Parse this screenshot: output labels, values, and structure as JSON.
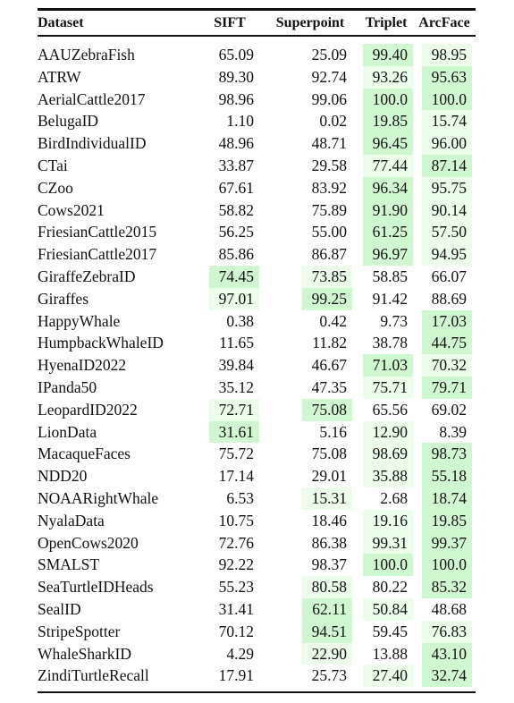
{
  "table": {
    "columns": [
      "Dataset",
      "SIFT",
      "Superpoint",
      "Triplet",
      "ArcFace"
    ],
    "highlight_colors": {
      "best": "#d0f8d0",
      "second": "#ecfdec"
    },
    "rows": [
      {
        "dataset": "AAUZebraFish",
        "values": [
          "65.09",
          "25.09",
          "99.40",
          "98.95"
        ],
        "marks": [
          "",
          "",
          "best",
          "second"
        ]
      },
      {
        "dataset": "ATRW",
        "values": [
          "89.30",
          "92.74",
          "93.26",
          "95.63"
        ],
        "marks": [
          "",
          "",
          "second",
          "best"
        ]
      },
      {
        "dataset": "AerialCattle2017",
        "values": [
          "98.96",
          "99.06",
          "100.0",
          "100.0"
        ],
        "marks": [
          "",
          "",
          "best",
          "best"
        ]
      },
      {
        "dataset": "BelugaID",
        "values": [
          "1.10",
          "0.02",
          "19.85",
          "15.74"
        ],
        "marks": [
          "",
          "",
          "best",
          "second"
        ]
      },
      {
        "dataset": "BirdIndividualID",
        "values": [
          "48.96",
          "48.71",
          "96.45",
          "96.00"
        ],
        "marks": [
          "",
          "",
          "best",
          "second"
        ]
      },
      {
        "dataset": "CTai",
        "values": [
          "33.87",
          "29.58",
          "77.44",
          "87.14"
        ],
        "marks": [
          "",
          "",
          "second",
          "best"
        ]
      },
      {
        "dataset": "CZoo",
        "values": [
          "67.61",
          "83.92",
          "96.34",
          "95.75"
        ],
        "marks": [
          "",
          "",
          "best",
          "second"
        ]
      },
      {
        "dataset": "Cows2021",
        "values": [
          "58.82",
          "75.89",
          "91.90",
          "90.14"
        ],
        "marks": [
          "",
          "",
          "best",
          "second"
        ]
      },
      {
        "dataset": "FriesianCattle2015",
        "values": [
          "56.25",
          "55.00",
          "61.25",
          "57.50"
        ],
        "marks": [
          "",
          "",
          "best",
          "second"
        ]
      },
      {
        "dataset": "FriesianCattle2017",
        "values": [
          "85.86",
          "86.87",
          "96.97",
          "94.95"
        ],
        "marks": [
          "",
          "",
          "best",
          "second"
        ]
      },
      {
        "dataset": "GiraffeZebraID",
        "values": [
          "74.45",
          "73.85",
          "58.85",
          "66.07"
        ],
        "marks": [
          "best",
          "second",
          "",
          ""
        ]
      },
      {
        "dataset": "Giraffes",
        "values": [
          "97.01",
          "99.25",
          "91.42",
          "88.69"
        ],
        "marks": [
          "second",
          "best",
          "",
          ""
        ]
      },
      {
        "dataset": "HappyWhale",
        "values": [
          "0.38",
          "0.42",
          "9.73",
          "17.03"
        ],
        "marks": [
          "",
          "",
          "",
          "best"
        ]
      },
      {
        "dataset": "HumpbackWhaleID",
        "values": [
          "11.65",
          "11.82",
          "38.78",
          "44.75"
        ],
        "marks": [
          "",
          "",
          "",
          "best"
        ]
      },
      {
        "dataset": "HyenaID2022",
        "values": [
          "39.84",
          "46.67",
          "71.03",
          "70.32"
        ],
        "marks": [
          "",
          "",
          "best",
          "second"
        ]
      },
      {
        "dataset": "IPanda50",
        "values": [
          "35.12",
          "47.35",
          "75.71",
          "79.71"
        ],
        "marks": [
          "",
          "",
          "second",
          "best"
        ]
      },
      {
        "dataset": "LeopardID2022",
        "values": [
          "72.71",
          "75.08",
          "65.56",
          "69.02"
        ],
        "marks": [
          "second",
          "best",
          "",
          ""
        ]
      },
      {
        "dataset": "LionData",
        "values": [
          "31.61",
          "5.16",
          "12.90",
          "8.39"
        ],
        "marks": [
          "best",
          "",
          "second",
          ""
        ]
      },
      {
        "dataset": "MacaqueFaces",
        "values": [
          "75.72",
          "75.08",
          "98.69",
          "98.73"
        ],
        "marks": [
          "",
          "",
          "second",
          "best"
        ]
      },
      {
        "dataset": "NDD20",
        "values": [
          "17.14",
          "29.01",
          "35.88",
          "55.18"
        ],
        "marks": [
          "",
          "",
          "second",
          "best"
        ]
      },
      {
        "dataset": "NOAARightWhale",
        "values": [
          "6.53",
          "15.31",
          "2.68",
          "18.74"
        ],
        "marks": [
          "",
          "second",
          "",
          "best"
        ]
      },
      {
        "dataset": "NyalaData",
        "values": [
          "10.75",
          "18.46",
          "19.16",
          "19.85"
        ],
        "marks": [
          "",
          "",
          "second",
          "best"
        ]
      },
      {
        "dataset": "OpenCows2020",
        "values": [
          "72.76",
          "86.38",
          "99.31",
          "99.37"
        ],
        "marks": [
          "",
          "",
          "second",
          "best"
        ]
      },
      {
        "dataset": "SMALST",
        "values": [
          "92.22",
          "98.37",
          "100.0",
          "100.0"
        ],
        "marks": [
          "",
          "",
          "best",
          "best"
        ]
      },
      {
        "dataset": "SeaTurtleIDHeads",
        "values": [
          "55.23",
          "80.58",
          "80.22",
          "85.32"
        ],
        "marks": [
          "",
          "second",
          "",
          "best"
        ]
      },
      {
        "dataset": "SealID",
        "values": [
          "31.41",
          "62.11",
          "50.84",
          "48.68"
        ],
        "marks": [
          "",
          "best",
          "second",
          ""
        ]
      },
      {
        "dataset": "StripeSpotter",
        "values": [
          "70.12",
          "94.51",
          "59.45",
          "76.83"
        ],
        "marks": [
          "",
          "best",
          "",
          "second"
        ]
      },
      {
        "dataset": "WhaleSharkID",
        "values": [
          "4.29",
          "22.90",
          "13.88",
          "43.10"
        ],
        "marks": [
          "",
          "second",
          "",
          "best"
        ]
      },
      {
        "dataset": "ZindiTurtleRecall",
        "values": [
          "17.91",
          "25.73",
          "27.40",
          "32.74"
        ],
        "marks": [
          "",
          "",
          "second",
          "best"
        ]
      }
    ]
  }
}
